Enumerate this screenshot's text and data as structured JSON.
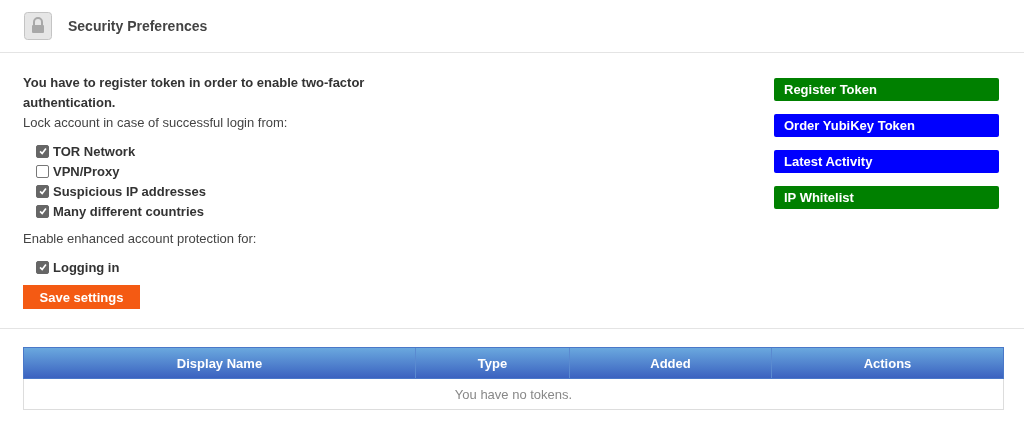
{
  "header": {
    "title": "Security Preferences"
  },
  "notice": "You have to register token in order to enable two-factor authentication.",
  "lock_section": {
    "label": "Lock account in case of successful login from:",
    "options": [
      {
        "label": "TOR Network",
        "checked": true
      },
      {
        "label": "VPN/Proxy",
        "checked": false
      },
      {
        "label": "Suspicious IP addresses",
        "checked": true
      },
      {
        "label": "Many different countries",
        "checked": true
      }
    ]
  },
  "protection_section": {
    "label": "Enable enhanced account protection for:",
    "options": [
      {
        "label": "Logging in",
        "checked": true
      }
    ]
  },
  "save_button": "Save settings",
  "action_buttons": [
    {
      "label": "Register Token",
      "color": "#008000"
    },
    {
      "label": "Order YubiKey Token",
      "color": "#0000ff"
    },
    {
      "label": "Latest Activity",
      "color": "#0000ff"
    },
    {
      "label": "IP Whitelist",
      "color": "#008000"
    }
  ],
  "table": {
    "columns": [
      "Display Name",
      "Type",
      "Added",
      "Actions"
    ],
    "empty_message": "You have no tokens."
  }
}
